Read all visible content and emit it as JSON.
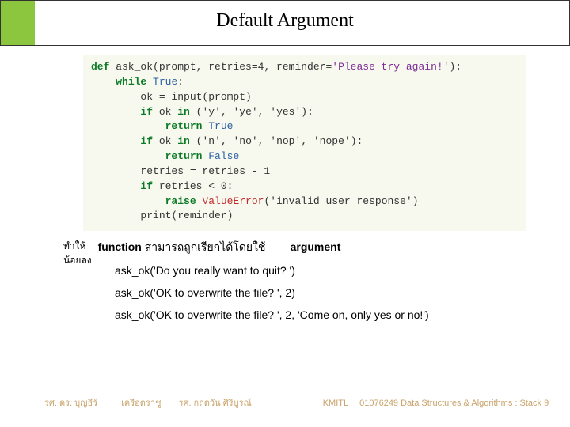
{
  "title": "Default Argument",
  "code": {
    "l1_def": "def",
    "l1_rest": " ask_ok(prompt, retries=4, reminder=",
    "l1_str": "'Please try again!'",
    "l1_end": "):",
    "l2_while": "while",
    "l2_true": "True",
    "l2_colon": ":",
    "l3": "        ok = input(prompt)",
    "l4_if": "if",
    "l4_mid": " ok ",
    "l4_in": "in",
    "l4_tuple": " ('y', 'ye', 'yes'):",
    "l5_return": "return",
    "l5_true": "True",
    "l6_if": "if",
    "l6_mid": " ok ",
    "l6_in": "in",
    "l6_tuple": " ('n', 'no', 'nop', 'nope'):",
    "l7_return": "return",
    "l7_false": "False",
    "l8": "        retries = retries - 1",
    "l9_if": "if",
    "l9_rest": " retries < 0:",
    "l10_raise": "raise",
    "l10_err": "ValueError",
    "l10_arg": "('invalid user response')",
    "l11": "        print(reminder)"
  },
  "desc": {
    "left_line1": "ทำให้",
    "left_line2": "น้อยลง",
    "bold1": "function",
    "mid": " สามารถถูกเรียกได้โดยใช้ ",
    "bold2": "argument"
  },
  "examples": {
    "e1": "ask_ok('Do you really want to quit? ')",
    "e2": "ask_ok('OK to overwrite the file? ', 2)",
    "e3": "ask_ok('OK to overwrite the file? ', 2, 'Come on, only yes or no!')"
  },
  "footer": {
    "f1": "รศ. ดร. บุญธีร์",
    "f2": "เครือตราชู",
    "f3": "รศ. กฤตวัน  ศิริบูรณ์",
    "f4": "KMITL",
    "f5": "01076249 Data Structures & Algorithms : Stack 9"
  }
}
